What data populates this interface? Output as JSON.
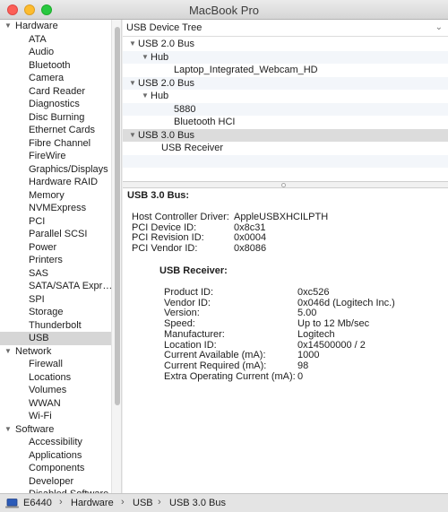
{
  "window": {
    "title": "MacBook Pro"
  },
  "sidebar": {
    "categories": [
      {
        "label": "Hardware",
        "items": [
          "ATA",
          "Audio",
          "Bluetooth",
          "Camera",
          "Card Reader",
          "Diagnostics",
          "Disc Burning",
          "Ethernet Cards",
          "Fibre Channel",
          "FireWire",
          "Graphics/Displays",
          "Hardware RAID",
          "Memory",
          "NVMExpress",
          "PCI",
          "Parallel SCSI",
          "Power",
          "Printers",
          "SAS",
          "SATA/SATA Expr…",
          "SPI",
          "Storage",
          "Thunderbolt",
          "USB"
        ]
      },
      {
        "label": "Network",
        "items": [
          "Firewall",
          "Locations",
          "Volumes",
          "WWAN",
          "Wi-Fi"
        ]
      },
      {
        "label": "Software",
        "items": [
          "Accessibility",
          "Applications",
          "Components",
          "Developer",
          "Disabled Software"
        ]
      }
    ],
    "selected_item": "USB"
  },
  "tree": {
    "header": "USB Device Tree",
    "rows": [
      {
        "label": "USB 2.0 Bus",
        "level": 0,
        "expanded": true
      },
      {
        "label": "Hub",
        "level": 1,
        "expanded": true
      },
      {
        "label": "Laptop_Integrated_Webcam_HD",
        "level": 2
      },
      {
        "label": "USB 2.0 Bus",
        "level": 0,
        "expanded": true
      },
      {
        "label": "Hub",
        "level": 1,
        "expanded": true
      },
      {
        "label": "5880",
        "level": 2
      },
      {
        "label": "Bluetooth HCI",
        "level": 2
      },
      {
        "label": "USB 3.0 Bus",
        "level": 0,
        "expanded": true,
        "selected": true
      },
      {
        "label": "USB Receiver",
        "level": 1
      }
    ]
  },
  "detail": {
    "title": "USB 3.0 Bus:",
    "bus_props": [
      {
        "key": "Host Controller Driver:",
        "value": "AppleUSBXHCILPTH"
      },
      {
        "key": "PCI Device ID:",
        "value": "0x8c31"
      },
      {
        "key": "PCI Revision ID:",
        "value": "0x0004"
      },
      {
        "key": "PCI Vendor ID:",
        "value": "0x8086"
      }
    ],
    "device_title": "USB Receiver:",
    "device_props": [
      {
        "key": "Product ID:",
        "value": "0xc526"
      },
      {
        "key": "Vendor ID:",
        "value": "0x046d  (Logitech Inc.)"
      },
      {
        "key": "Version:",
        "value": "5.00"
      },
      {
        "key": "Speed:",
        "value": "Up to 12 Mb/sec"
      },
      {
        "key": "Manufacturer:",
        "value": "Logitech"
      },
      {
        "key": "Location ID:",
        "value": "0x14500000 / 2"
      },
      {
        "key": "Current Available (mA):",
        "value": "1000"
      },
      {
        "key": "Current Required (mA):",
        "value": "98"
      },
      {
        "key": "Extra Operating Current (mA):",
        "value": "0"
      }
    ]
  },
  "statusbar": {
    "path": [
      "E6440",
      "Hardware",
      "USB",
      "USB 3.0 Bus"
    ],
    "separator": "›"
  },
  "icons": {
    "triangle_expanded": "▼",
    "triangle_collapsed": "▶",
    "header_chevron": "⌄"
  },
  "colors": {
    "selection": "#d6d6d6",
    "alt_row": "#f3f6fa",
    "close": "#fc5f57",
    "minimize": "#fdbc2e",
    "maximize": "#28c840"
  }
}
